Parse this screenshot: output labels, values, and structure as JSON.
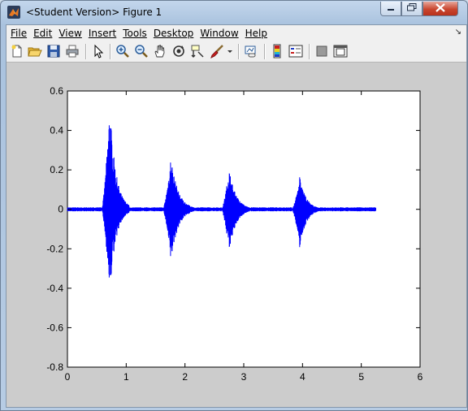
{
  "window": {
    "title": "<Student Version> Figure 1",
    "minimize_icon": "minimize-icon",
    "maximize_icon": "maximize-icon",
    "close_icon": "close-icon"
  },
  "menu": {
    "items": [
      "File",
      "Edit",
      "View",
      "Insert",
      "Tools",
      "Desktop",
      "Window",
      "Help"
    ],
    "dock_arrow_icon": "dock-arrow-icon"
  },
  "toolbar": {
    "icons": [
      "new-figure-icon",
      "open-file-icon",
      "save-icon",
      "print-icon",
      "edit-plot-arrow-icon",
      "zoom-in-icon",
      "zoom-out-icon",
      "pan-hand-icon",
      "rotate-3d-icon",
      "data-cursor-icon",
      "brush-icon",
      "brush-dropdown-icon",
      "link-plot-icon",
      "colorbar-icon",
      "legend-icon",
      "hide-plot-tools-icon",
      "show-plot-tools-icon"
    ]
  },
  "colors": {
    "signal": "#0000ff",
    "figure_bg": "#cccccc",
    "axes_bg": "#ffffff"
  },
  "chart_data": {
    "type": "line",
    "title": "",
    "xlabel": "",
    "ylabel": "",
    "xlim": [
      0,
      6
    ],
    "ylim": [
      -0.8,
      0.6
    ],
    "xticks": [
      "0",
      "1",
      "2",
      "3",
      "4",
      "5",
      "6"
    ],
    "yticks": [
      "0.6",
      "0.4",
      "0.2",
      "0",
      "-0.2",
      "-0.4",
      "-0.6",
      "-0.8"
    ],
    "grid": false,
    "series": [
      {
        "signal_end": 5.25,
        "bursts": [
          {
            "start": 0.58,
            "peak": 0.72,
            "end": 1.05,
            "max": 0.53,
            "min": -0.43
          },
          {
            "start": 1.62,
            "peak": 1.76,
            "end": 2.15,
            "max": 0.27,
            "min": -0.27
          },
          {
            "start": 2.62,
            "peak": 2.75,
            "end": 3.12,
            "max": 0.21,
            "min": -0.22
          },
          {
            "start": 3.82,
            "peak": 3.95,
            "end": 4.3,
            "max": 0.17,
            "min": -0.2
          }
        ]
      }
    ]
  }
}
